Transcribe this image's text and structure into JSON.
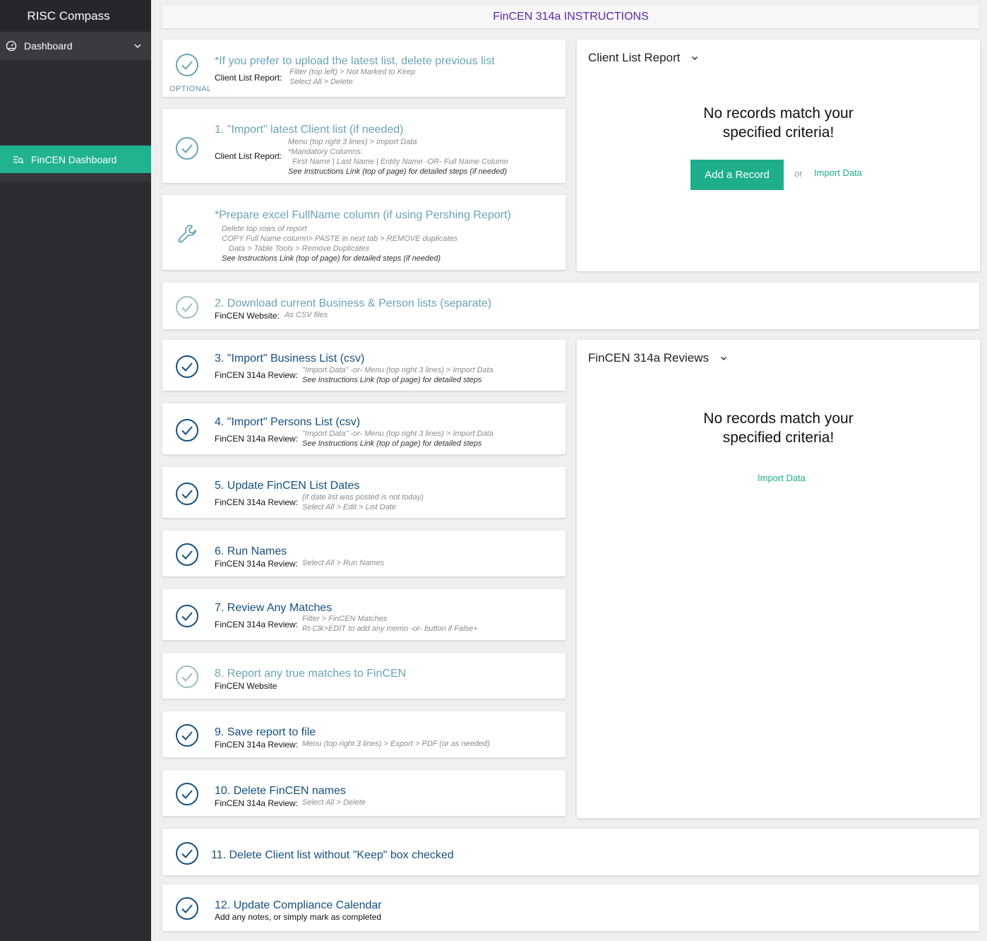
{
  "sidebar": {
    "brand": "RISC Compass",
    "dashboard_label": "Dashboard",
    "active_label": "FinCEN Dashboard"
  },
  "header": {
    "title": "FinCEN 314a INSTRUCTIONS"
  },
  "steps": [
    {
      "title": "*If you prefer to upload the latest list, delete previous list",
      "label": "Client List Report:",
      "lines": [
        "Filter (top left) > Not Marked to Keep",
        "Select All > Delete"
      ],
      "badge": "OPTIONAL"
    },
    {
      "title": "1. \"Import\" latest Client list (if needed)",
      "label": "Client List Report:",
      "lines": [
        "Menu (top right 3 lines) > Import Data",
        "*Mandatory Columns:",
        "First Name | Last Name | Entity Name -OR- Full Name Column",
        "See Instructions Link (top of page) for detailed steps (if needed)"
      ]
    },
    {
      "title": "*Prepare excel FullName column (if using Pershing Report)",
      "lines": [
        "Delete top rows of report",
        "COPY Full Name column> PASTE in next tab > REMOVE duplicates",
        "Data > Table Tools > Remove Duplicates",
        "See Instructions Link (top of page) for detailed steps (if needed)"
      ]
    },
    {
      "title": "2. Download current Business & Person lists (separate)",
      "label": "FinCEN Website:",
      "lines": [
        "As CSV files"
      ]
    },
    {
      "title": "3. \"Import\" Business List (csv)",
      "label": "FinCEN 314a Review:",
      "lines": [
        "\"Import Data\" -or- Menu (top right 3 lines) > Import Data",
        "See Instructions Link (top of page) for detailed steps"
      ]
    },
    {
      "title": "4. \"Import\" Persons List (csv)",
      "label": "FinCEN 314a Review:",
      "lines": [
        "\"Import Data\" -or- Menu (top right 3 lines) > Import Data",
        "See Instructions Link (top of page) for detailed steps"
      ]
    },
    {
      "title": "5. Update FinCEN List Dates",
      "label": "FinCEN 314a Review:",
      "lines": [
        "(if date list was posted is not today)",
        "Select All > Edit > List Date"
      ]
    },
    {
      "title": "6. Run Names",
      "label": "FinCEN 314a Review:",
      "lines": [
        "Select All > Run Names"
      ]
    },
    {
      "title": "7. Review Any Matches",
      "label": "FinCEN 314a Review:",
      "lines": [
        "Filter > FinCEN Matches",
        "Rt-Clk>EDIT to add any memo -or- button if False+"
      ]
    },
    {
      "title": "8. Report any true matches to FinCEN",
      "label": "FinCEN Website"
    },
    {
      "title": "9. Save report to file",
      "label": "FinCEN 314a Review:",
      "lines": [
        "Menu (top right 3 lines) > Export > PDF (or as needed)"
      ]
    },
    {
      "title": "10. Delete FinCEN names",
      "label": "FinCEN 314a Review:",
      "lines": [
        "Select All > Delete"
      ]
    },
    {
      "title": "11. Delete Client list without \"Keep\" box checked"
    },
    {
      "title": "12. Update Compliance Calendar",
      "label": "Add any notes, or simply mark as completed"
    }
  ],
  "client_panel": {
    "title": "Client List Report",
    "empty_line1": "No records match your",
    "empty_line2": "specified criteria!",
    "add_button": "Add a Record",
    "or_text": "or",
    "import_link": "Import Data"
  },
  "reviews_panel": {
    "title": "FinCEN 314a Reviews",
    "empty_line1": "No records match your",
    "empty_line2": "specified criteria!",
    "import_link": "Import Data"
  }
}
